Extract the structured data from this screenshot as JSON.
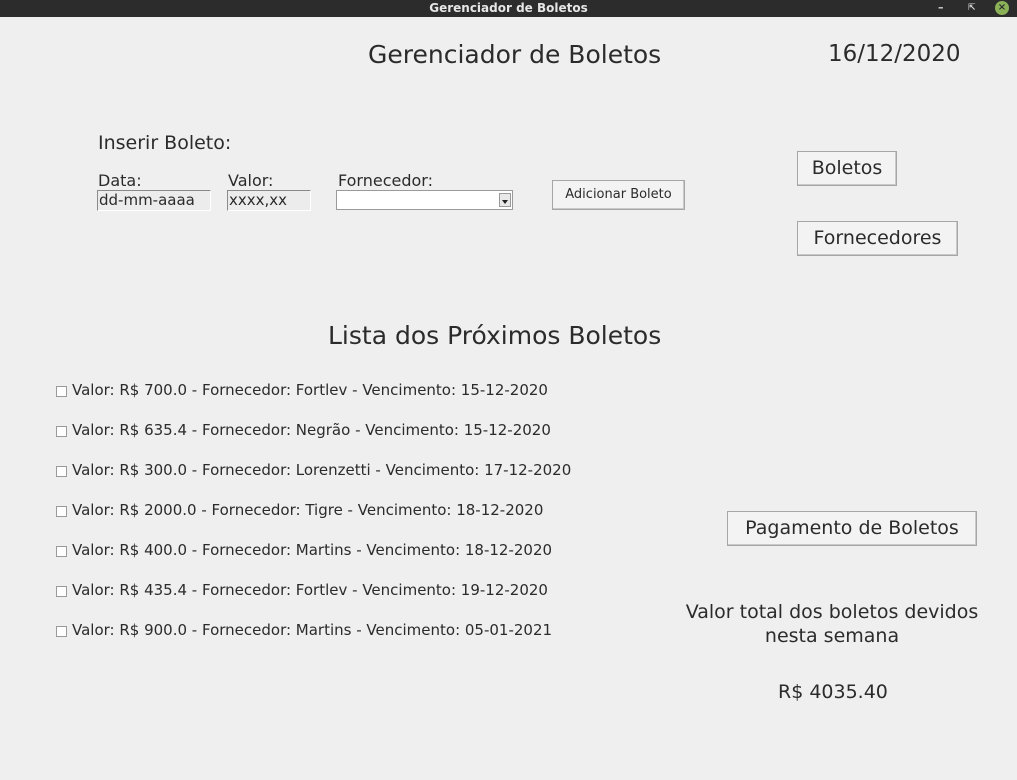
{
  "window": {
    "title": "Gerenciador de Boletos"
  },
  "header": {
    "title": "Gerenciador de Boletos",
    "date": "16/12/2020"
  },
  "insert_form": {
    "section_label": "Inserir Boleto:",
    "data_label": "Data:",
    "data_value": "dd-mm-aaaa",
    "valor_label": "Valor:",
    "valor_value": "xxxx,xx",
    "fornecedor_label": "Fornecedor:",
    "fornecedor_selected": "",
    "add_button": "Adicionar Boleto"
  },
  "nav": {
    "boletos_button": "Boletos",
    "fornecedores_button": "Fornecedores"
  },
  "list": {
    "title": "Lista dos Próximos Boletos",
    "items": [
      {
        "text": "Valor: R$ 700.0 - Fornecedor: Fortlev - Vencimento: 15-12-2020",
        "checked": false
      },
      {
        "text": "Valor: R$ 635.4 - Fornecedor: Negrão - Vencimento: 15-12-2020",
        "checked": false
      },
      {
        "text": "Valor: R$ 300.0 - Fornecedor: Lorenzetti - Vencimento: 17-12-2020",
        "checked": false
      },
      {
        "text": "Valor: R$ 2000.0 - Fornecedor: Tigre - Vencimento: 18-12-2020",
        "checked": false
      },
      {
        "text": "Valor: R$ 400.0 - Fornecedor: Martins - Vencimento: 18-12-2020",
        "checked": false
      },
      {
        "text": "Valor: R$ 435.4 - Fornecedor: Fortlev - Vencimento: 19-12-2020",
        "checked": false
      },
      {
        "text": "Valor: R$ 900.0 - Fornecedor: Martins - Vencimento: 05-01-2021",
        "checked": false
      }
    ]
  },
  "payment": {
    "button": "Pagamento de Boletos",
    "total_label": "Valor total dos boletos devidos nesta semana",
    "total_value": "R$ 4035.40"
  },
  "colors": {
    "background": "#efefef",
    "titlebar": "#2c2c2c",
    "close_button": "#8bb158"
  },
  "icons": {
    "minimize": "minimize-icon",
    "maximize": "maximize-icon",
    "close": "close-icon",
    "combo_arrow": "chevron-down-icon"
  }
}
